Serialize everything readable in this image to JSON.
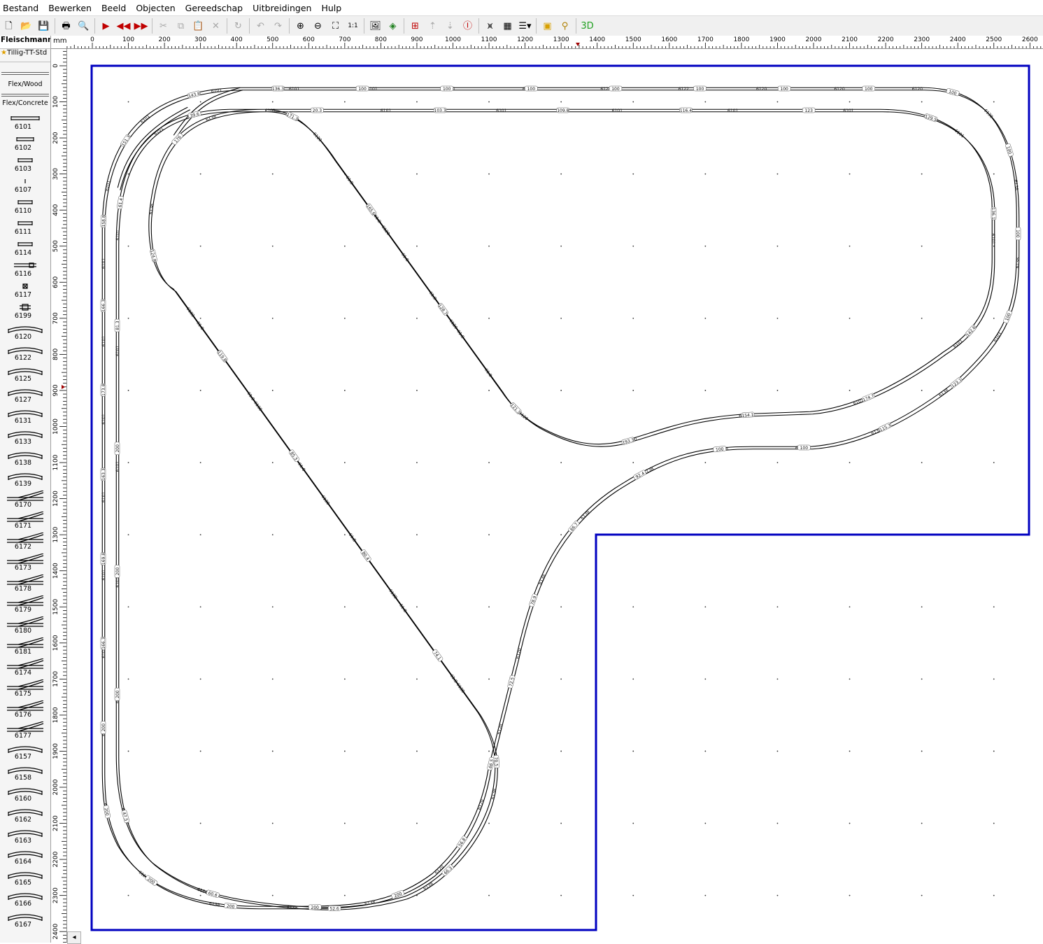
{
  "menu": [
    "Bestand",
    "Bewerken",
    "Beeld",
    "Objecten",
    "Gereedschap",
    "Uitbreidingen",
    "Hulp"
  ],
  "toolbar": [
    {
      "name": "new-file-icon",
      "glyph": "🗋",
      "enabled": true
    },
    {
      "name": "open-folder-icon",
      "glyph": "📂",
      "enabled": true
    },
    {
      "name": "save-icon",
      "glyph": "💾",
      "enabled": true
    },
    {
      "sep": true
    },
    {
      "name": "print-icon",
      "glyph": "🖶",
      "enabled": true
    },
    {
      "name": "print-preview-icon",
      "glyph": "🔍",
      "enabled": true
    },
    {
      "sep": true
    },
    {
      "name": "play-icon",
      "glyph": "▶",
      "enabled": true,
      "color": "#c00000"
    },
    {
      "name": "rewind-icon",
      "glyph": "◀◀",
      "enabled": true,
      "color": "#c00000"
    },
    {
      "name": "fast-forward-icon",
      "glyph": "▶▶",
      "enabled": true,
      "color": "#c00000"
    },
    {
      "sep": true
    },
    {
      "name": "cut-icon",
      "glyph": "✂",
      "enabled": false
    },
    {
      "name": "copy-icon",
      "glyph": "⧉",
      "enabled": false
    },
    {
      "name": "paste-icon",
      "glyph": "📋",
      "enabled": false
    },
    {
      "name": "delete-icon",
      "glyph": "✕",
      "enabled": false
    },
    {
      "sep": true
    },
    {
      "name": "rotate-icon",
      "glyph": "↻",
      "enabled": false
    },
    {
      "sep": true
    },
    {
      "name": "undo-icon",
      "glyph": "↶",
      "enabled": false
    },
    {
      "name": "redo-icon",
      "glyph": "↷",
      "enabled": false
    },
    {
      "sep": true
    },
    {
      "name": "zoom-in-icon",
      "glyph": "⊕",
      "enabled": true
    },
    {
      "name": "zoom-out-icon",
      "glyph": "⊖",
      "enabled": true
    },
    {
      "name": "zoom-fit-icon",
      "glyph": "⛶",
      "enabled": true
    },
    {
      "name": "zoom-1to1-icon",
      "glyph": "1:1",
      "enabled": true
    },
    {
      "sep": true
    },
    {
      "name": "background-image-icon",
      "glyph": "🖼",
      "enabled": true
    },
    {
      "name": "layers-icon",
      "glyph": "◈",
      "enabled": true,
      "color": "#208020"
    },
    {
      "sep": true
    },
    {
      "name": "height-marker-icon",
      "glyph": "⊞",
      "enabled": true,
      "color": "#c00000"
    },
    {
      "name": "height-up-icon",
      "glyph": "⇡",
      "enabled": false
    },
    {
      "name": "height-down-icon",
      "glyph": "⇣",
      "enabled": false
    },
    {
      "name": "height-info-icon",
      "glyph": "Ⓘ",
      "enabled": true,
      "color": "#c00000"
    },
    {
      "sep": true
    },
    {
      "name": "bridge-icon",
      "glyph": "⩙",
      "enabled": true
    },
    {
      "name": "tunnel-icon",
      "glyph": "▦",
      "enabled": true
    },
    {
      "name": "list-dropdown-icon",
      "glyph": "☰▾",
      "enabled": true
    },
    {
      "sep": true
    },
    {
      "name": "3d-box-icon",
      "glyph": "▣",
      "enabled": true,
      "color": "#d8a000"
    },
    {
      "name": "measure-icon",
      "glyph": "⚲",
      "enabled": true,
      "color": "#b08000"
    },
    {
      "sep": true
    },
    {
      "name": "3d-view-icon",
      "glyph": "3D",
      "enabled": true,
      "color": "#20a020"
    }
  ],
  "library": {
    "selected": "Fleischmann-I",
    "favorite": "Tillig-TT-Std",
    "flex_wood": "Flex/Wood",
    "flex_concrete": "Flex/Concrete",
    "items": [
      "6101",
      "6102",
      "6103",
      "6107",
      "6110",
      "6111",
      "6114",
      "6116",
      "6117",
      "6199",
      "6120",
      "6122",
      "6125",
      "6127",
      "6131",
      "6133",
      "6138",
      "6139",
      "6170",
      "6171",
      "6172",
      "6173",
      "6178",
      "6179",
      "6180",
      "6181",
      "6174",
      "6175",
      "6176",
      "6177",
      "6157",
      "6158",
      "6160",
      "6162",
      "6163",
      "6164",
      "6165",
      "6166",
      "6167"
    ]
  },
  "ruler": {
    "unit": "mm",
    "x_labels": [
      "0",
      "100",
      "200",
      "300",
      "400",
      "500",
      "600",
      "700",
      "800",
      "900",
      "1000",
      "1100",
      "1200",
      "1300",
      "1400",
      "1500",
      "1600",
      "1700",
      "1800",
      "1900",
      "2000",
      "2100",
      "2200",
      "2300",
      "2400",
      "2500",
      "2600"
    ],
    "y_labels": [
      "0",
      "100",
      "200",
      "300",
      "400",
      "500",
      "600",
      "700",
      "800",
      "900",
      "1000",
      "1100",
      "1200",
      "1300",
      "1400",
      "1500",
      "1600",
      "1700",
      "1800",
      "1900",
      "2000",
      "2100",
      "2200",
      "2300",
      "2400"
    ]
  },
  "layout": {
    "border_color": "#0000c0",
    "track_color": "#000000",
    "outer_loop_labels": [
      "6101",
      "6101",
      "6101",
      "6101",
      "6101",
      "6101",
      "6101",
      "6101",
      "6101",
      "6101",
      "6101",
      "6101",
      "6101",
      "6103",
      "6120",
      "6122",
      "6120",
      "6120",
      "6120",
      "6138",
      "6138",
      "6138",
      "6103",
      "6138",
      "6138",
      "6138",
      "6138",
      "6138",
      "6138",
      "6138",
      "6120",
      "6120",
      "6120",
      "6120",
      "6138",
      "6138",
      "6138",
      "6120",
      "6120"
    ],
    "inner_loop_labels": [
      "6101",
      "6101",
      "6101",
      "6101",
      "6101",
      "6101",
      "6101",
      "6101",
      "6101",
      "6101",
      "6101",
      "6101",
      "6101",
      "6101",
      "6101",
      "6103",
      "6120",
      "6120",
      "6120",
      "6120",
      "6120",
      "6120",
      "6138",
      "6138",
      "6103",
      "6138",
      "6138",
      "6138",
      "6138",
      "6138",
      "6138",
      "6120",
      "6120",
      "6120"
    ],
    "diagonal_labels": [
      "61.8",
      "61.8",
      "61.8",
      "61.8",
      "61.8",
      "61.8",
      "61.8",
      "61.8",
      "61.8",
      "61.8",
      "61.8",
      "61.8"
    ],
    "height_tags": [
      "200",
      "166.3",
      "169.8",
      "163.3",
      "173.8",
      "166.3",
      "158.8",
      "151.3",
      "143.8",
      "136.3",
      "100",
      "100",
      "100",
      "100",
      "100",
      "100",
      "100",
      "100",
      "100",
      "100",
      "100",
      "123.1",
      "115.3",
      "100",
      "100",
      "92.4",
      "86.7",
      "78.9",
      "72.5",
      "66.5",
      "56.8",
      "200",
      "200",
      "200",
      "200",
      "200",
      "200",
      "200",
      "200",
      "81.3",
      "61.4",
      "39.6",
      "20.3",
      "103.3",
      "109.8",
      "116.4",
      "123",
      "129.5",
      "136.1",
      "142.6",
      "174.7",
      "154.1",
      "193.3",
      "121.3",
      "128.7",
      "165.6",
      "171.3",
      "176",
      "124.8",
      "119.8",
      "85.3",
      "80.4",
      "74.1",
      "70.5",
      "66.3",
      "52.6",
      "60.6",
      "47.5"
    ]
  }
}
